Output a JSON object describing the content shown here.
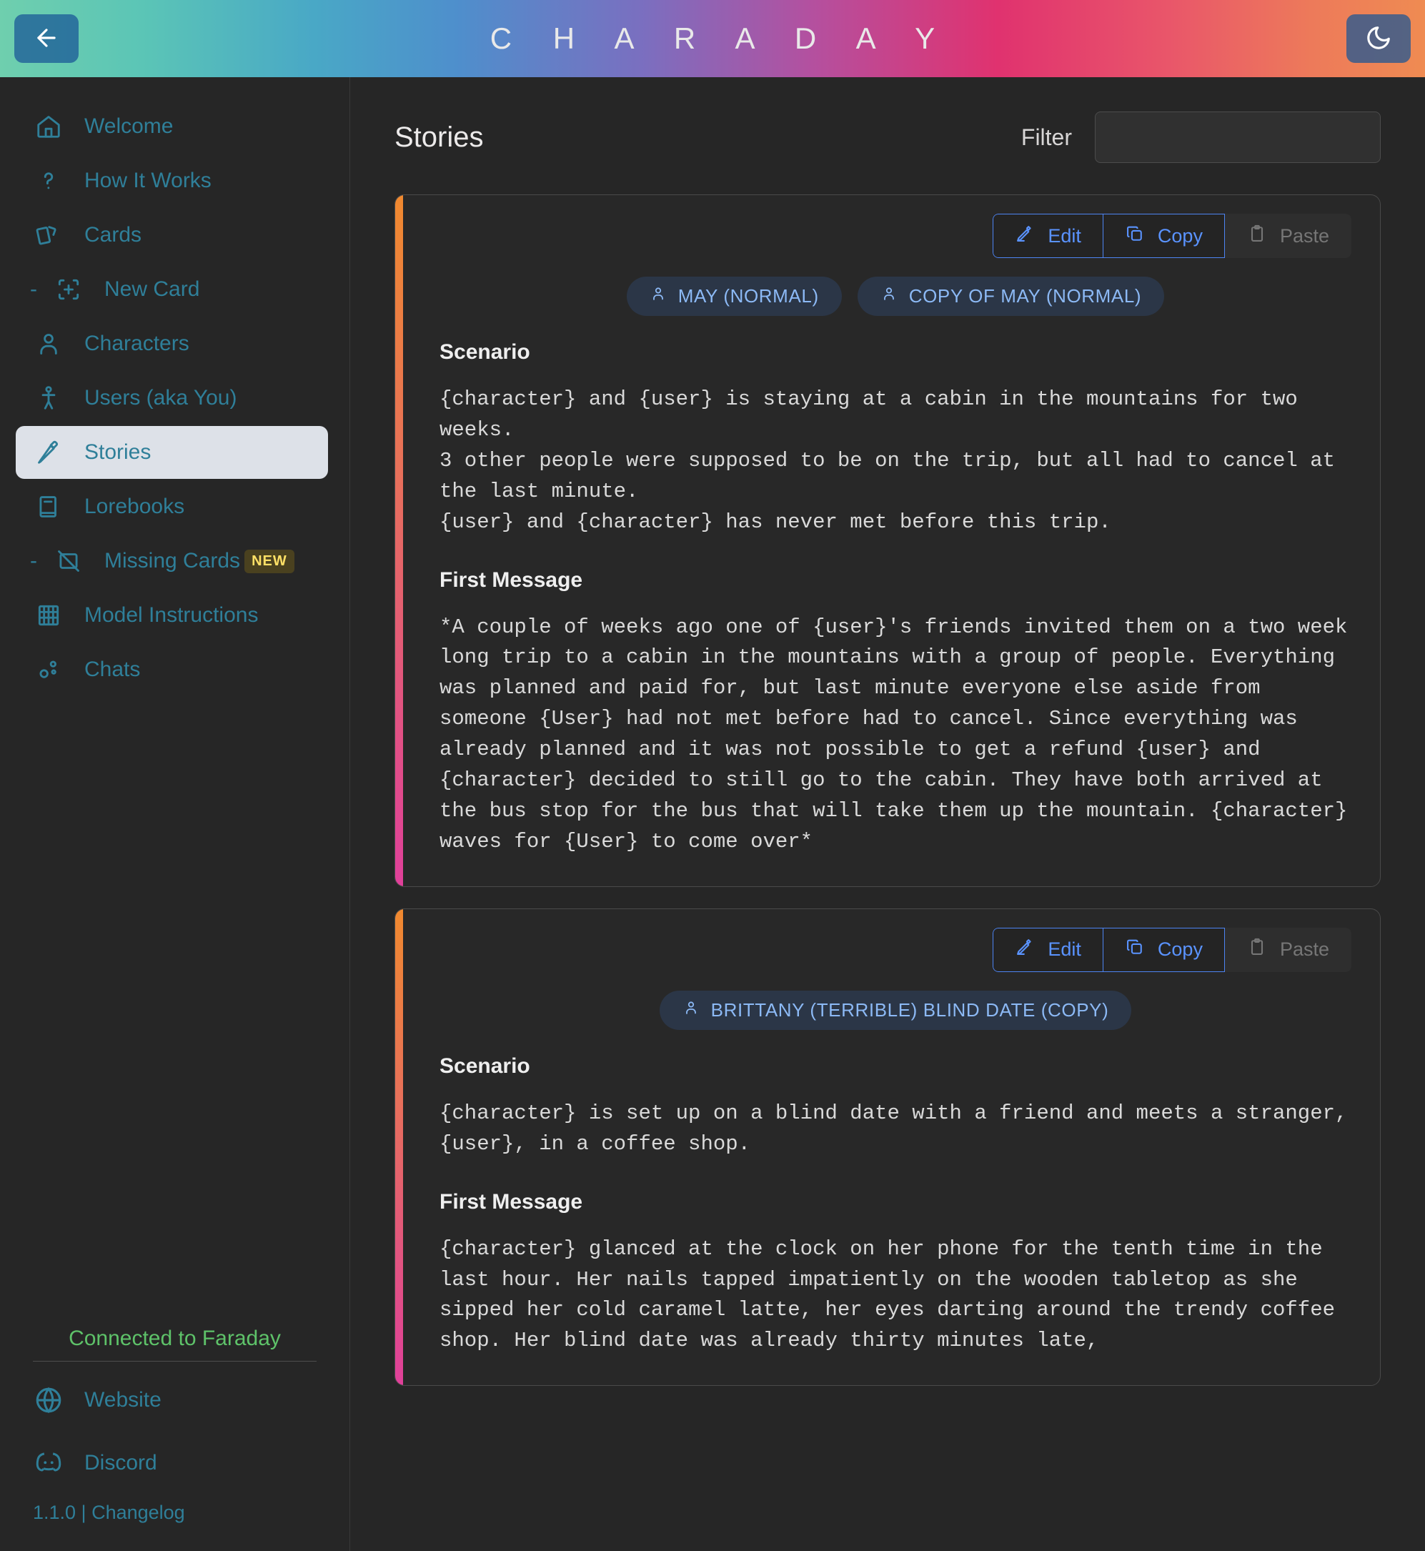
{
  "header": {
    "title": "C H A R A D A Y",
    "back_icon": "arrow-left-icon",
    "theme_icon": "moon-icon"
  },
  "sidebar": {
    "items": [
      {
        "label": "Welcome",
        "icon": "home-icon",
        "sub": false,
        "active": false,
        "badge": ""
      },
      {
        "label": "How It Works",
        "icon": "question-mark-icon",
        "sub": false,
        "active": false,
        "badge": ""
      },
      {
        "label": "Cards",
        "icon": "cards-icon",
        "sub": false,
        "active": false,
        "badge": ""
      },
      {
        "label": "New Card",
        "icon": "plus-square-icon",
        "sub": true,
        "active": false,
        "badge": ""
      },
      {
        "label": "Characters",
        "icon": "person-icon",
        "sub": false,
        "active": false,
        "badge": ""
      },
      {
        "label": "Users (aka You)",
        "icon": "user-stick-icon",
        "sub": false,
        "active": false,
        "badge": ""
      },
      {
        "label": "Stories",
        "icon": "pencil-icon",
        "sub": false,
        "active": true,
        "badge": ""
      },
      {
        "label": "Lorebooks",
        "icon": "book-icon",
        "sub": false,
        "active": false,
        "badge": ""
      },
      {
        "label": "Missing Cards",
        "icon": "card-off-icon",
        "sub": true,
        "active": false,
        "badge": "NEW"
      },
      {
        "label": "Model Instructions",
        "icon": "abacus-icon",
        "sub": false,
        "active": false,
        "badge": ""
      },
      {
        "label": "Chats",
        "icon": "chat-nodes-icon",
        "sub": false,
        "active": false,
        "badge": ""
      }
    ],
    "footer": {
      "connection_status": "Connected to Faraday",
      "links": [
        {
          "label": "Website",
          "icon": "globe-icon"
        },
        {
          "label": "Discord",
          "icon": "discord-icon"
        }
      ],
      "version_line": "1.1.0 | Changelog"
    }
  },
  "main": {
    "page_title": "Stories",
    "filter_label": "Filter",
    "filter_value": "",
    "filter_placeholder": "",
    "toolbar": {
      "edit_label": "Edit",
      "copy_label": "Copy",
      "paste_label": "Paste",
      "edit_icon": "pencil-square-icon",
      "copy_icon": "copy-icon",
      "paste_icon": "clipboard-icon"
    },
    "labels": {
      "scenario": "Scenario",
      "first_message": "First Message"
    },
    "stories": [
      {
        "tags": [
          "MAY (NORMAL)",
          "COPY OF MAY (NORMAL)"
        ],
        "scenario": "{character} and {user} is staying at a cabin in the mountains for two weeks.\n3 other people were supposed to be on the trip, but all had to cancel at the last minute.\n{user} and {character} has never met before this trip.",
        "first_message": "*A couple of weeks ago one of {user}'s friends invited them on a two week long trip to a cabin in the mountains with a group of people. Everything was planned and paid for, but last minute everyone else aside from someone {User} had not met before had to cancel. Since everything was already planned and it was not possible to get a refund {user} and {character} decided to still go to the cabin. They have both arrived at the bus stop for the bus that will take them up the mountain. {character} waves for {User} to come over*"
      },
      {
        "tags": [
          "BRITTANY (TERRIBLE) BLIND DATE (COPY)"
        ],
        "scenario": "{character} is set up on a blind date with a friend and meets a stranger, {user}, in a coffee shop.",
        "first_message": "{character} glanced at the clock on her phone for the tenth time in the last hour. Her nails tapped impatiently on the wooden tabletop as she sipped her cold caramel latte, her eyes darting around the trendy coffee shop. Her blind date was already thirty minutes late,"
      }
    ]
  },
  "colors": {
    "accent_teal": "#2f7f99",
    "accent_blue": "#5a93ff",
    "status_green": "#5ec269",
    "badge_yellow": "#ffe066",
    "card_accent_start": "#f0892f",
    "card_accent_end": "#e0409a"
  }
}
